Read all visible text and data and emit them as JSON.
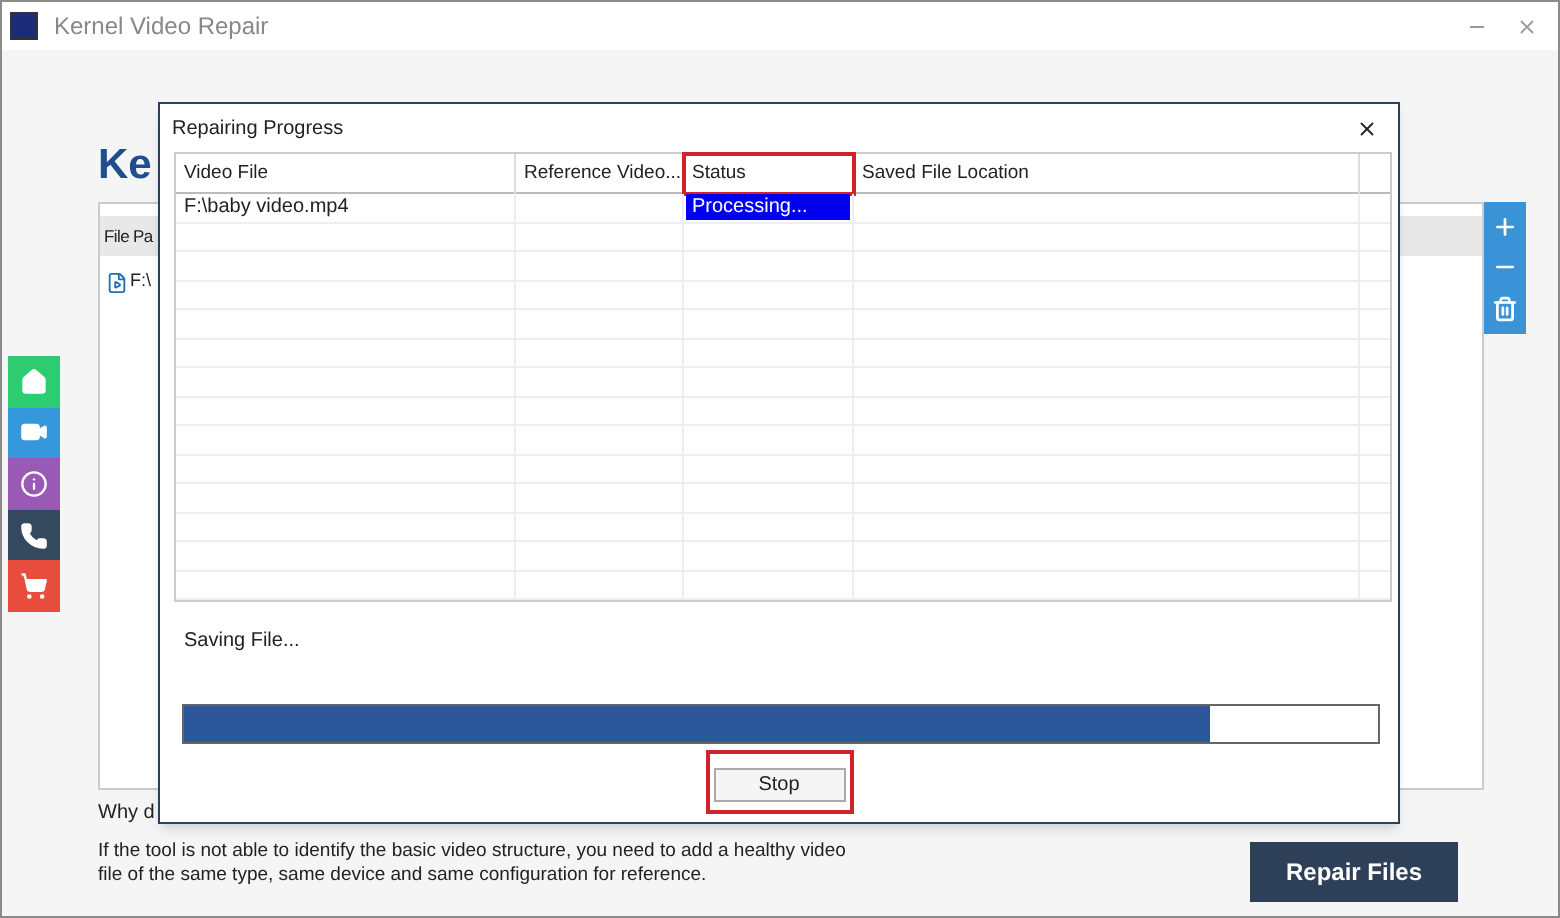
{
  "window": {
    "title": "Kernel Video Repair"
  },
  "background": {
    "logo_text": "Ke",
    "file_table": {
      "column_1": "File Pa",
      "rows": [
        {
          "path": "F:\\"
        }
      ]
    },
    "side_nav": [
      {
        "kind": "home",
        "color": "#2ecc71"
      },
      {
        "kind": "video",
        "color": "#3498db"
      },
      {
        "kind": "info",
        "color": "#9b59b6"
      },
      {
        "kind": "phone",
        "color": "#34495e"
      },
      {
        "kind": "cart",
        "color": "#e74c3c"
      }
    ],
    "toolbar": [
      {
        "kind": "add"
      },
      {
        "kind": "remove"
      },
      {
        "kind": "delete"
      }
    ],
    "question": "Why d",
    "info": "If the tool is not able to identify the basic video structure, you need to add a healthy video file of the same type, same device and same configuration for reference.",
    "repair_button": "Repair Files"
  },
  "dialog": {
    "title": "Repairing Progress",
    "columns": [
      {
        "label": "Video File",
        "highlighted": false
      },
      {
        "label": "Reference Video...",
        "highlighted": false
      },
      {
        "label": "Status",
        "highlighted": true
      },
      {
        "label": "Saved File Location",
        "highlighted": false
      }
    ],
    "rows": [
      {
        "video_file": "F:\\baby video.mp4",
        "status": "Processing...",
        "selected": true
      }
    ],
    "status_text": "Saving File...",
    "progress": {
      "level": 0.86
    },
    "stop_button": {
      "label": "Stop",
      "highlighted": true
    }
  }
}
